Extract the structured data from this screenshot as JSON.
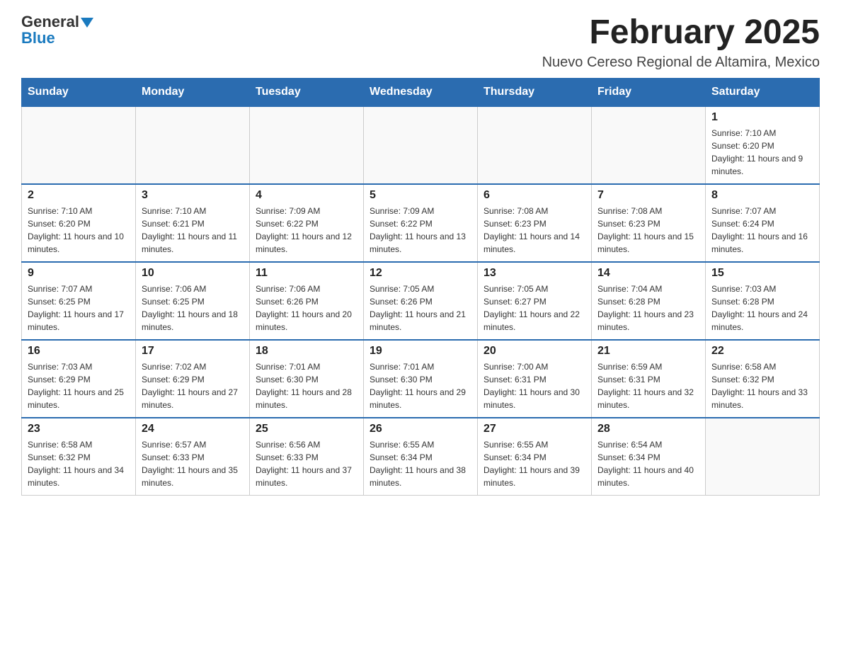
{
  "header": {
    "logo_general": "General",
    "logo_blue": "Blue",
    "month_title": "February 2025",
    "location": "Nuevo Cereso Regional de Altamira, Mexico"
  },
  "weekdays": [
    "Sunday",
    "Monday",
    "Tuesday",
    "Wednesday",
    "Thursday",
    "Friday",
    "Saturday"
  ],
  "weeks": [
    [
      {
        "day": "",
        "info": ""
      },
      {
        "day": "",
        "info": ""
      },
      {
        "day": "",
        "info": ""
      },
      {
        "day": "",
        "info": ""
      },
      {
        "day": "",
        "info": ""
      },
      {
        "day": "",
        "info": ""
      },
      {
        "day": "1",
        "info": "Sunrise: 7:10 AM\nSunset: 6:20 PM\nDaylight: 11 hours and 9 minutes."
      }
    ],
    [
      {
        "day": "2",
        "info": "Sunrise: 7:10 AM\nSunset: 6:20 PM\nDaylight: 11 hours and 10 minutes."
      },
      {
        "day": "3",
        "info": "Sunrise: 7:10 AM\nSunset: 6:21 PM\nDaylight: 11 hours and 11 minutes."
      },
      {
        "day": "4",
        "info": "Sunrise: 7:09 AM\nSunset: 6:22 PM\nDaylight: 11 hours and 12 minutes."
      },
      {
        "day": "5",
        "info": "Sunrise: 7:09 AM\nSunset: 6:22 PM\nDaylight: 11 hours and 13 minutes."
      },
      {
        "day": "6",
        "info": "Sunrise: 7:08 AM\nSunset: 6:23 PM\nDaylight: 11 hours and 14 minutes."
      },
      {
        "day": "7",
        "info": "Sunrise: 7:08 AM\nSunset: 6:23 PM\nDaylight: 11 hours and 15 minutes."
      },
      {
        "day": "8",
        "info": "Sunrise: 7:07 AM\nSunset: 6:24 PM\nDaylight: 11 hours and 16 minutes."
      }
    ],
    [
      {
        "day": "9",
        "info": "Sunrise: 7:07 AM\nSunset: 6:25 PM\nDaylight: 11 hours and 17 minutes."
      },
      {
        "day": "10",
        "info": "Sunrise: 7:06 AM\nSunset: 6:25 PM\nDaylight: 11 hours and 18 minutes."
      },
      {
        "day": "11",
        "info": "Sunrise: 7:06 AM\nSunset: 6:26 PM\nDaylight: 11 hours and 20 minutes."
      },
      {
        "day": "12",
        "info": "Sunrise: 7:05 AM\nSunset: 6:26 PM\nDaylight: 11 hours and 21 minutes."
      },
      {
        "day": "13",
        "info": "Sunrise: 7:05 AM\nSunset: 6:27 PM\nDaylight: 11 hours and 22 minutes."
      },
      {
        "day": "14",
        "info": "Sunrise: 7:04 AM\nSunset: 6:28 PM\nDaylight: 11 hours and 23 minutes."
      },
      {
        "day": "15",
        "info": "Sunrise: 7:03 AM\nSunset: 6:28 PM\nDaylight: 11 hours and 24 minutes."
      }
    ],
    [
      {
        "day": "16",
        "info": "Sunrise: 7:03 AM\nSunset: 6:29 PM\nDaylight: 11 hours and 25 minutes."
      },
      {
        "day": "17",
        "info": "Sunrise: 7:02 AM\nSunset: 6:29 PM\nDaylight: 11 hours and 27 minutes."
      },
      {
        "day": "18",
        "info": "Sunrise: 7:01 AM\nSunset: 6:30 PM\nDaylight: 11 hours and 28 minutes."
      },
      {
        "day": "19",
        "info": "Sunrise: 7:01 AM\nSunset: 6:30 PM\nDaylight: 11 hours and 29 minutes."
      },
      {
        "day": "20",
        "info": "Sunrise: 7:00 AM\nSunset: 6:31 PM\nDaylight: 11 hours and 30 minutes."
      },
      {
        "day": "21",
        "info": "Sunrise: 6:59 AM\nSunset: 6:31 PM\nDaylight: 11 hours and 32 minutes."
      },
      {
        "day": "22",
        "info": "Sunrise: 6:58 AM\nSunset: 6:32 PM\nDaylight: 11 hours and 33 minutes."
      }
    ],
    [
      {
        "day": "23",
        "info": "Sunrise: 6:58 AM\nSunset: 6:32 PM\nDaylight: 11 hours and 34 minutes."
      },
      {
        "day": "24",
        "info": "Sunrise: 6:57 AM\nSunset: 6:33 PM\nDaylight: 11 hours and 35 minutes."
      },
      {
        "day": "25",
        "info": "Sunrise: 6:56 AM\nSunset: 6:33 PM\nDaylight: 11 hours and 37 minutes."
      },
      {
        "day": "26",
        "info": "Sunrise: 6:55 AM\nSunset: 6:34 PM\nDaylight: 11 hours and 38 minutes."
      },
      {
        "day": "27",
        "info": "Sunrise: 6:55 AM\nSunset: 6:34 PM\nDaylight: 11 hours and 39 minutes."
      },
      {
        "day": "28",
        "info": "Sunrise: 6:54 AM\nSunset: 6:34 PM\nDaylight: 11 hours and 40 minutes."
      },
      {
        "day": "",
        "info": ""
      }
    ]
  ]
}
